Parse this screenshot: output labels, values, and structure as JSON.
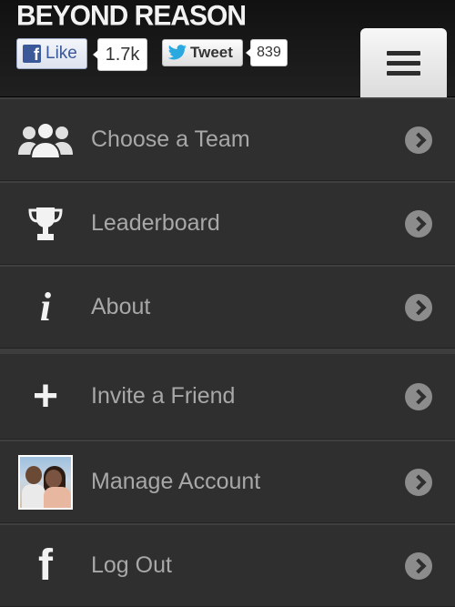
{
  "header": {
    "brand": "BEYOND REASON",
    "facebook": {
      "label": "Like",
      "count": "1.7k",
      "icon": "f"
    },
    "twitter": {
      "label": "Tweet",
      "count": "839"
    }
  },
  "menu": {
    "items": [
      {
        "label": "Choose a Team",
        "icon": "team-icon"
      },
      {
        "label": "Leaderboard",
        "icon": "trophy-icon"
      },
      {
        "label": "About",
        "icon": "info-icon",
        "glyph": "i"
      },
      {
        "label": "Invite a Friend",
        "icon": "plus-icon",
        "glyph": "+"
      },
      {
        "label": "Manage Account",
        "icon": "avatar"
      },
      {
        "label": "Log Out",
        "icon": "facebook-icon",
        "glyph": "f"
      }
    ]
  }
}
